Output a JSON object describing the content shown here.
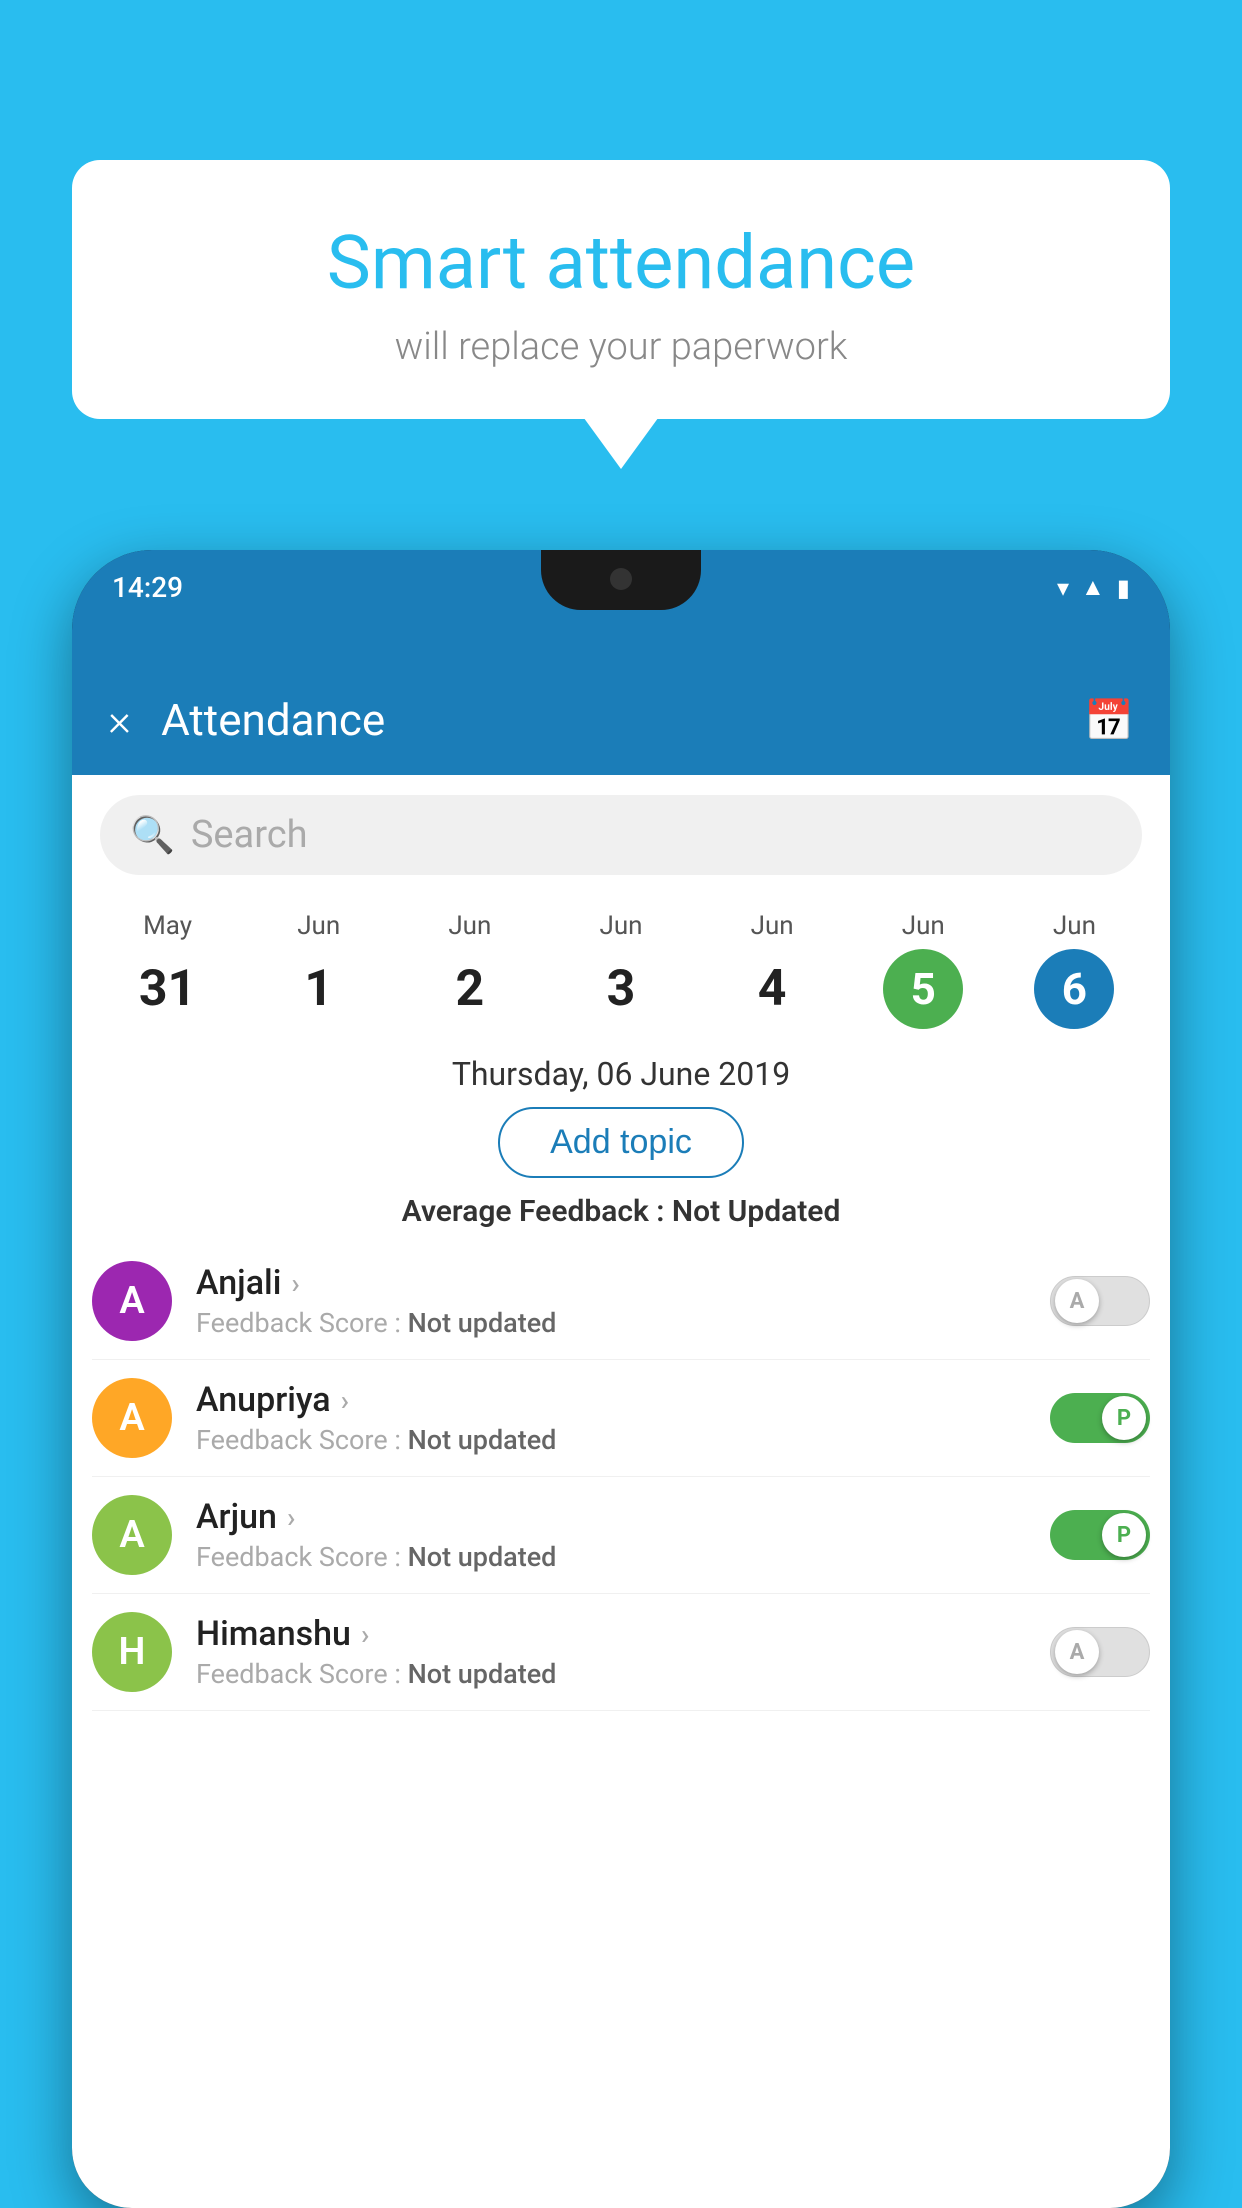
{
  "background": {
    "color": "#29BDEF"
  },
  "bubble": {
    "title": "Smart attendance",
    "subtitle": "will replace your paperwork"
  },
  "status_bar": {
    "time": "14:29",
    "icons": [
      "wifi",
      "signal",
      "battery"
    ]
  },
  "app_bar": {
    "title": "Attendance",
    "close_label": "×",
    "calendar_icon": "📅"
  },
  "search": {
    "placeholder": "Search"
  },
  "dates": [
    {
      "month": "May",
      "day": "31",
      "style": "normal"
    },
    {
      "month": "Jun",
      "day": "1",
      "style": "normal"
    },
    {
      "month": "Jun",
      "day": "2",
      "style": "normal"
    },
    {
      "month": "Jun",
      "day": "3",
      "style": "normal"
    },
    {
      "month": "Jun",
      "day": "4",
      "style": "normal"
    },
    {
      "month": "Jun",
      "day": "5",
      "style": "today"
    },
    {
      "month": "Jun",
      "day": "6",
      "style": "selected"
    }
  ],
  "selected_date": "Thursday, 06 June 2019",
  "add_topic_label": "Add topic",
  "avg_feedback_label": "Average Feedback :",
  "avg_feedback_value": "Not Updated",
  "students": [
    {
      "name": "Anjali",
      "avatar_letter": "A",
      "avatar_color": "#9C27B0",
      "feedback_label": "Feedback Score :",
      "feedback_value": "Not updated",
      "attendance": "absent",
      "toggle_label": "A"
    },
    {
      "name": "Anupriya",
      "avatar_letter": "A",
      "avatar_color": "#FFA726",
      "feedback_label": "Feedback Score :",
      "feedback_value": "Not updated",
      "attendance": "present",
      "toggle_label": "P"
    },
    {
      "name": "Arjun",
      "avatar_letter": "A",
      "avatar_color": "#8BC34A",
      "feedback_label": "Feedback Score :",
      "feedback_value": "Not updated",
      "attendance": "present",
      "toggle_label": "P"
    },
    {
      "name": "Himanshu",
      "avatar_letter": "H",
      "avatar_color": "#8BC34A",
      "feedback_label": "Feedback Score :",
      "feedback_value": "Not updated",
      "attendance": "absent",
      "toggle_label": "A"
    }
  ]
}
